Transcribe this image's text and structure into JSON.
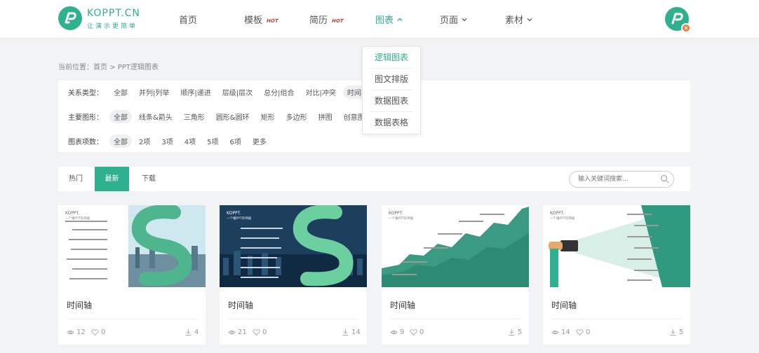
{
  "header": {
    "logo_text": "KOPPT.CN",
    "logo_slogan": "让演示更简单",
    "nav": [
      {
        "label": "首页",
        "hot": false,
        "dropdown": false
      },
      {
        "label": "模板",
        "hot": true,
        "dropdown": false
      },
      {
        "label": "简历",
        "hot": true,
        "dropdown": false
      },
      {
        "label": "图表",
        "hot": false,
        "dropdown": true,
        "active": true
      },
      {
        "label": "页面",
        "hot": false,
        "dropdown": true
      },
      {
        "label": "素材",
        "hot": false,
        "dropdown": true
      }
    ],
    "hot_badge": "HOT"
  },
  "dropdown": {
    "items": [
      "逻辑图表",
      "图文排版",
      "数据图表",
      "数据表格"
    ],
    "active_index": 0
  },
  "breadcrumb": "当前位置：首页 > PPT逻辑图表",
  "filters": {
    "relation": {
      "label": "关系类型：",
      "options": [
        "全部",
        "并列|列举",
        "顺序|递进",
        "层级|层次",
        "总分|组合",
        "对比|冲突",
        "时间轴"
      ],
      "selected": 6
    },
    "shape": {
      "label": "主要图形：",
      "options": [
        "全部",
        "线条&箭头",
        "三角形",
        "圆形&圆环",
        "矩形",
        "多边形",
        "拼图",
        "创意图"
      ],
      "selected": 0
    },
    "count": {
      "label": "图表项数：",
      "options": [
        "全部",
        "2项",
        "3项",
        "4项",
        "5项",
        "6项",
        "更多"
      ],
      "selected": 0
    }
  },
  "tabs": [
    "热门",
    "最新",
    "下载"
  ],
  "active_tab": 1,
  "search": {
    "placeholder": "输入关键词搜索..."
  },
  "cards": [
    {
      "title": "时间轴",
      "views": "12",
      "likes": "0",
      "downloads": "4"
    },
    {
      "title": "时间轴",
      "views": "21",
      "likes": "0",
      "downloads": "14"
    },
    {
      "title": "时间轴",
      "views": "9",
      "likes": "0",
      "downloads": "5"
    },
    {
      "title": "时间轴",
      "views": "14",
      "likes": "0",
      "downloads": "5"
    }
  ],
  "thumb_text": {
    "brand": "KOPPT.",
    "sub": "一个懂PPT的神器"
  },
  "colors": {
    "accent": "#2fb08f",
    "hot": "#e53935",
    "badge": "#ef7b3a"
  }
}
